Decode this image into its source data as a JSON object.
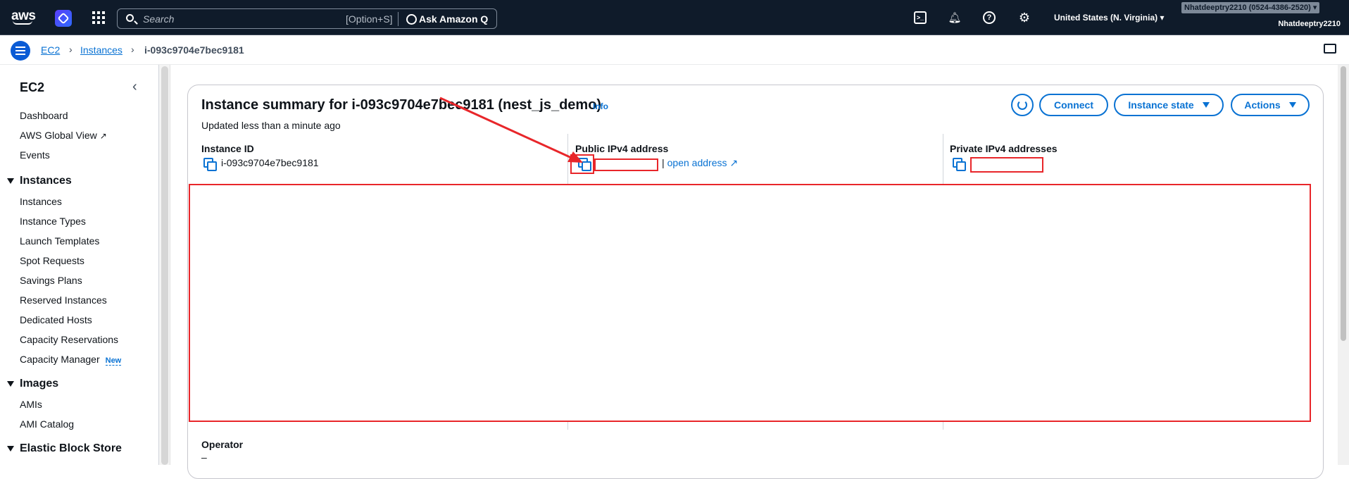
{
  "topnav": {
    "logo_text": "aws",
    "search_placeholder": "Search",
    "search_shortcut": "[Option+S]",
    "ask_q_label": "Ask Amazon Q",
    "region": "United States (N. Virginia) ▾",
    "account": "Nhatdeeptry2210 (0524-4386-2520) ▾",
    "username": "Nhatdeeptry2210"
  },
  "breadcrumb": {
    "items": [
      "EC2",
      "Instances",
      "i-093c9704e7bec9181"
    ]
  },
  "sidebar": {
    "title": "EC2",
    "top_items": [
      "Dashboard",
      "AWS Global View",
      "Events"
    ],
    "sections": [
      {
        "title": "Instances",
        "items": [
          "Instances",
          "Instance Types",
          "Launch Templates",
          "Spot Requests",
          "Savings Plans",
          "Reserved Instances",
          "Dedicated Hosts",
          "Capacity Reservations",
          "Capacity Manager"
        ]
      },
      {
        "title": "Images",
        "items": [
          "AMIs",
          "AMI Catalog"
        ]
      },
      {
        "title": "Elastic Block Store",
        "items": []
      }
    ],
    "new_badge": "New"
  },
  "summary": {
    "title": "Instance summary for i-093c9704e7bec9181 (nest_js_demo)",
    "info_link": "Info",
    "updated": "Updated less than a minute ago",
    "buttons": {
      "connect": "Connect",
      "instance_state": "Instance state",
      "actions": "Actions"
    },
    "fields": {
      "instance_id_label": "Instance ID",
      "instance_id_value": "i-093c9704e7bec9181",
      "public_ip_label": "Public IPv4 address",
      "open_address": "open address",
      "pipe": "|",
      "private_ip_label": "Private IPv4 addresses",
      "operator_label": "Operator",
      "operator_value": "–"
    }
  },
  "annotation_colors": {
    "highlight": "#e8262a"
  }
}
